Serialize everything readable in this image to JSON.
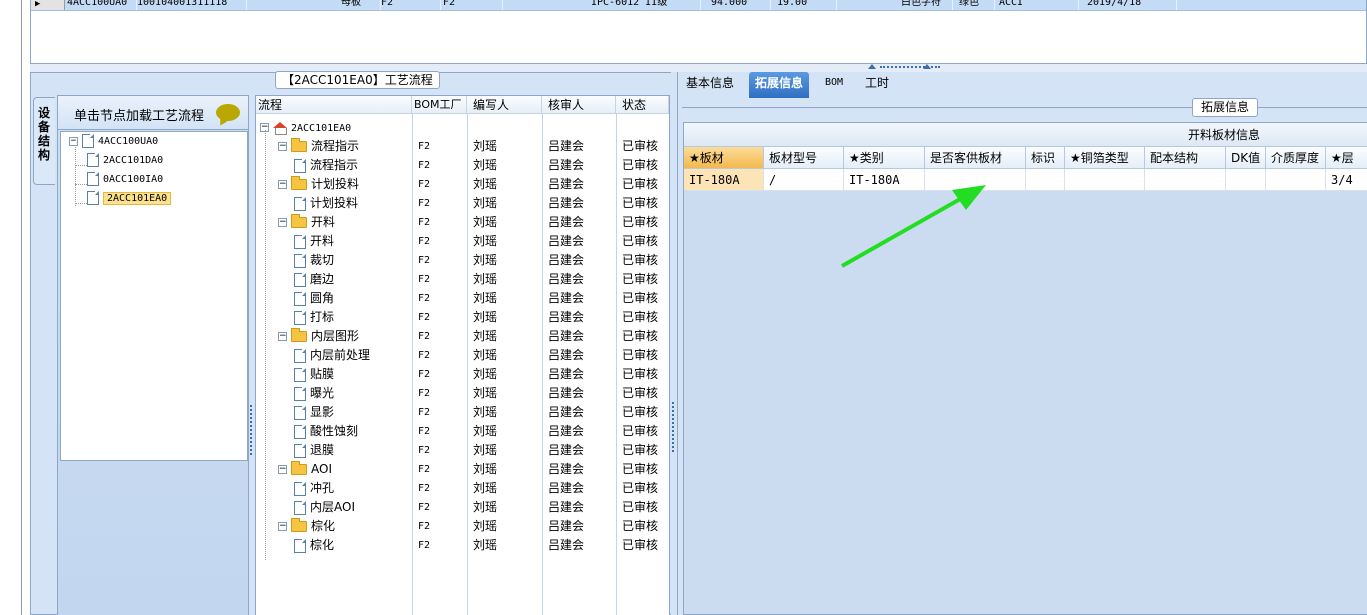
{
  "top_grid": {
    "row_indicator": "▶",
    "row": [
      "4ACC100UA0",
      "100104001311118",
      "母板",
      "F2",
      "F2",
      "",
      "IPC-6012 II级",
      "94.000",
      "19.00",
      "",
      "白色字符",
      "绿色",
      "ACCI",
      "2019/4/18"
    ]
  },
  "left_panel": {
    "title": "【2ACC101EA0】工艺流程",
    "vertical_tab": "设备结构",
    "struct_header": "单击节点加载工艺流程",
    "tree": [
      {
        "label": "4ACC100UA0",
        "expander": "−"
      },
      {
        "label": "2ACC101DA0"
      },
      {
        "label": "0ACC100IA0"
      },
      {
        "label": "2ACC101EA0",
        "selected": true
      }
    ]
  },
  "flow": {
    "columns": [
      "流程",
      "BOM工厂",
      "编写人",
      "核审人",
      "状态"
    ],
    "root": "2ACC101EA0",
    "rows": [
      {
        "name": "流程指示",
        "level": 1,
        "type": "folder",
        "factory": "F2",
        "writer": "刘瑶",
        "reviewer": "吕建会",
        "status": "已审核"
      },
      {
        "name": "流程指示",
        "level": 2,
        "type": "doc",
        "factory": "F2",
        "writer": "刘瑶",
        "reviewer": "吕建会",
        "status": "已审核"
      },
      {
        "name": "计划投料",
        "level": 1,
        "type": "folder",
        "factory": "F2",
        "writer": "刘瑶",
        "reviewer": "吕建会",
        "status": "已审核"
      },
      {
        "name": "计划投料",
        "level": 2,
        "type": "doc",
        "factory": "F2",
        "writer": "刘瑶",
        "reviewer": "吕建会",
        "status": "已审核"
      },
      {
        "name": "开料",
        "level": 1,
        "type": "folder",
        "factory": "F2",
        "writer": "刘瑶",
        "reviewer": "吕建会",
        "status": "已审核"
      },
      {
        "name": "开料",
        "level": 2,
        "type": "doc",
        "factory": "F2",
        "writer": "刘瑶",
        "reviewer": "吕建会",
        "status": "已审核"
      },
      {
        "name": "裁切",
        "level": 2,
        "type": "doc",
        "factory": "F2",
        "writer": "刘瑶",
        "reviewer": "吕建会",
        "status": "已审核"
      },
      {
        "name": "磨边",
        "level": 2,
        "type": "doc",
        "factory": "F2",
        "writer": "刘瑶",
        "reviewer": "吕建会",
        "status": "已审核"
      },
      {
        "name": "圆角",
        "level": 2,
        "type": "doc",
        "factory": "F2",
        "writer": "刘瑶",
        "reviewer": "吕建会",
        "status": "已审核"
      },
      {
        "name": "打标",
        "level": 2,
        "type": "doc",
        "factory": "F2",
        "writer": "刘瑶",
        "reviewer": "吕建会",
        "status": "已审核"
      },
      {
        "name": "内层图形",
        "level": 1,
        "type": "folder",
        "factory": "F2",
        "writer": "刘瑶",
        "reviewer": "吕建会",
        "status": "已审核"
      },
      {
        "name": "内层前处理",
        "level": 2,
        "type": "doc",
        "factory": "F2",
        "writer": "刘瑶",
        "reviewer": "吕建会",
        "status": "已审核"
      },
      {
        "name": "贴膜",
        "level": 2,
        "type": "doc",
        "factory": "F2",
        "writer": "刘瑶",
        "reviewer": "吕建会",
        "status": "已审核"
      },
      {
        "name": "曝光",
        "level": 2,
        "type": "doc",
        "factory": "F2",
        "writer": "刘瑶",
        "reviewer": "吕建会",
        "status": "已审核"
      },
      {
        "name": "显影",
        "level": 2,
        "type": "doc",
        "factory": "F2",
        "writer": "刘瑶",
        "reviewer": "吕建会",
        "status": "已审核"
      },
      {
        "name": "酸性蚀刻",
        "level": 2,
        "type": "doc",
        "factory": "F2",
        "writer": "刘瑶",
        "reviewer": "吕建会",
        "status": "已审核"
      },
      {
        "name": "退膜",
        "level": 2,
        "type": "doc",
        "factory": "F2",
        "writer": "刘瑶",
        "reviewer": "吕建会",
        "status": "已审核"
      },
      {
        "name": "AOI",
        "level": 1,
        "type": "folder",
        "factory": "F2",
        "writer": "刘瑶",
        "reviewer": "吕建会",
        "status": "已审核"
      },
      {
        "name": "冲孔",
        "level": 2,
        "type": "doc",
        "factory": "F2",
        "writer": "刘瑶",
        "reviewer": "吕建会",
        "status": "已审核"
      },
      {
        "name": "内层AOI",
        "level": 2,
        "type": "doc",
        "factory": "F2",
        "writer": "刘瑶",
        "reviewer": "吕建会",
        "status": "已审核"
      },
      {
        "name": "棕化",
        "level": 1,
        "type": "folder",
        "factory": "F2",
        "writer": "刘瑶",
        "reviewer": "吕建会",
        "status": "已审核"
      },
      {
        "name": "棕化",
        "level": 2,
        "type": "doc",
        "factory": "F2",
        "writer": "刘瑶",
        "reviewer": "吕建会",
        "status": "已审核"
      }
    ]
  },
  "right_panel": {
    "tabs": [
      "基本信息",
      "拓展信息",
      "BOM",
      "工时"
    ],
    "active_tab": 1,
    "group_title": "拓展信息",
    "table_title": "开料板材信息",
    "columns": [
      "★板材",
      "板材型号",
      "★类别",
      "是否客供板材",
      "标识",
      "★铜箔类型",
      "配本结构",
      "DK值",
      "介质厚度",
      "★层"
    ],
    "row": [
      "IT-180A",
      "/",
      "IT-180A",
      "",
      "",
      "",
      "",
      "",
      "",
      "3/4"
    ]
  },
  "colors": {
    "panel_bg": "#d4e3f5",
    "border": "#8ea7c7",
    "selected_row": "#c4dbf5",
    "active_tab": "#2f6fc0",
    "highlight_cell": "#fce4b6",
    "annotation_arrow": "#22dd22"
  }
}
